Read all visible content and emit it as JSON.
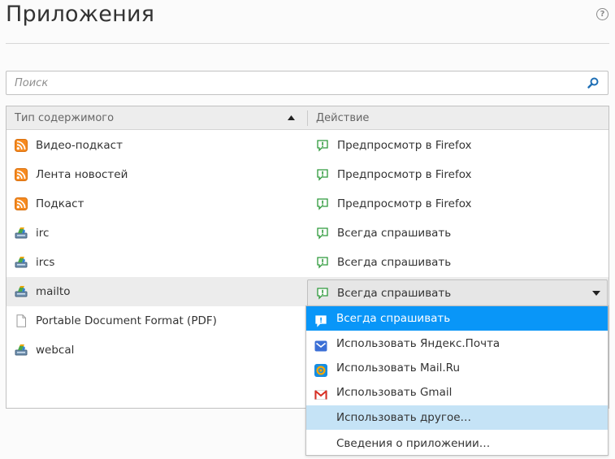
{
  "page": {
    "title": "Приложения"
  },
  "search": {
    "placeholder": "Поиск"
  },
  "table": {
    "columns": {
      "type": "Тип содержимого",
      "action": "Действие"
    },
    "rows": [
      {
        "type": "Видео-подкаст",
        "type_icon": "rss-feed-icon",
        "action": "Предпросмотр в Firefox",
        "action_icon": "preview-icon"
      },
      {
        "type": "Лента новостей",
        "type_icon": "rss-feed-icon",
        "action": "Предпросмотр в Firefox",
        "action_icon": "preview-icon"
      },
      {
        "type": "Подкаст",
        "type_icon": "rss-feed-icon",
        "action": "Предпросмотр в Firefox",
        "action_icon": "preview-icon"
      },
      {
        "type": "irc",
        "type_icon": "protocol-icon",
        "action": "Всегда спрашивать",
        "action_icon": "ask-icon"
      },
      {
        "type": "ircs",
        "type_icon": "protocol-icon",
        "action": "Всегда спрашивать",
        "action_icon": "ask-icon"
      },
      {
        "type": "mailto",
        "type_icon": "protocol-icon",
        "action": "Всегда спрашивать",
        "action_icon": "ask-icon"
      },
      {
        "type": "Portable Document Format (PDF)",
        "type_icon": "document-icon",
        "action": "",
        "action_icon": ""
      },
      {
        "type": "webcal",
        "type_icon": "protocol-icon",
        "action": "",
        "action_icon": ""
      }
    ]
  },
  "dropdown": {
    "selected": "Всегда спрашивать",
    "options": [
      {
        "label": "Всегда спрашивать",
        "icon": "ask-icon",
        "state": "selected"
      },
      {
        "label": "Использовать Яндекс.Почта",
        "icon": "yandex-mail-icon",
        "state": ""
      },
      {
        "label": "Использовать Mail.Ru",
        "icon": "mailru-icon",
        "state": ""
      },
      {
        "label": "Использовать Gmail",
        "icon": "gmail-icon",
        "state": ""
      },
      {
        "label": "Использовать другое…",
        "icon": "",
        "state": "hover"
      },
      {
        "label": "Сведения о приложении…",
        "icon": "",
        "state": ""
      }
    ]
  },
  "colors": {
    "accent": "#0996f8",
    "hover": "#c5e3f6",
    "rss": "#f68a1f",
    "ask": "#2f9a3c"
  }
}
